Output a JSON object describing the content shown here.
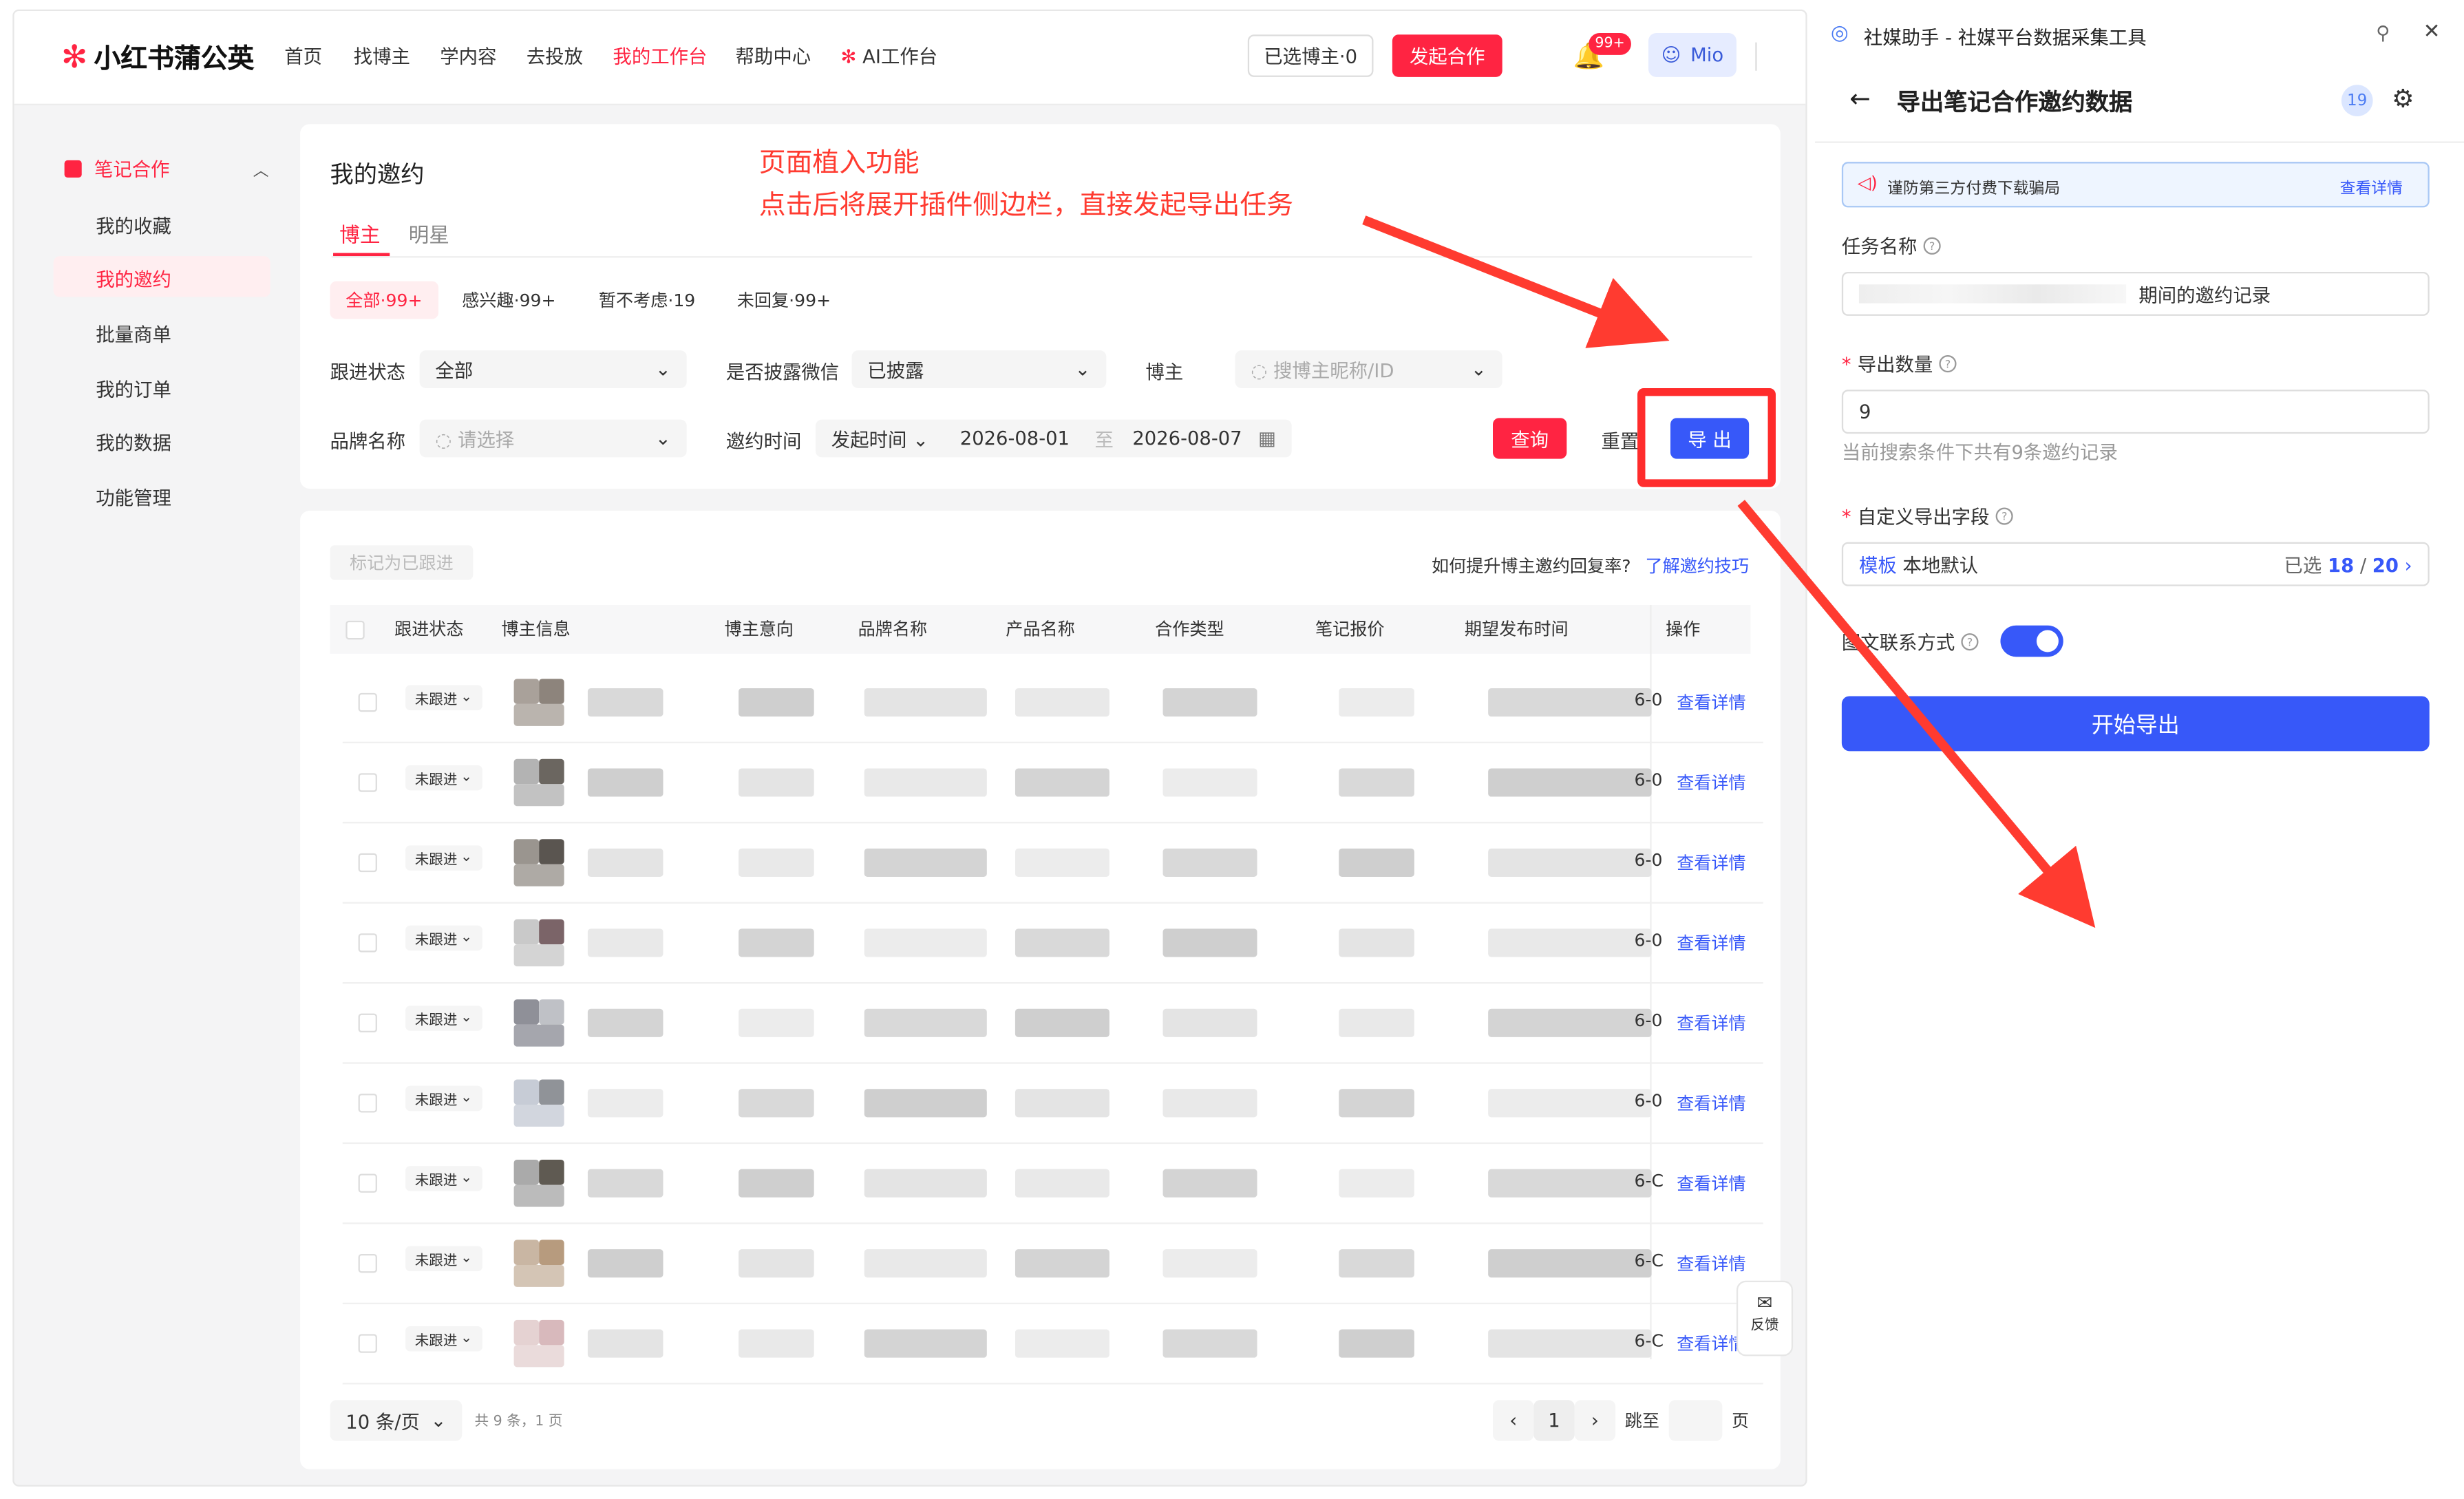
{
  "app": {
    "brand": "小红书蒲公英",
    "nav": [
      "首页",
      "找博主",
      "学内容",
      "去投放",
      "我的工作台",
      "帮助中心",
      "AI工作台"
    ],
    "active_nav": "我的工作台",
    "selected_bloggers": "已选博主·0",
    "start_collab": "发起合作",
    "notif_badge": "99+",
    "user": "Mio"
  },
  "sidebar": {
    "section": "笔记合作",
    "items": [
      "我的收藏",
      "我的邀约",
      "批量商单",
      "我的订单",
      "我的数据",
      "功能管理"
    ],
    "active": "我的邀约"
  },
  "main": {
    "title": "我的邀约",
    "tabs": [
      "博主",
      "明星"
    ],
    "chips": [
      "全部·99+",
      "感兴趣·99+",
      "暂不考虑·19",
      "未回复·99+"
    ],
    "filters": {
      "follow_label": "跟进状态",
      "follow_value": "全部",
      "wechat_label": "是否披露微信",
      "wechat_value": "已披露",
      "blogger_label": "博主",
      "blogger_placeholder": "搜博主昵称/ID",
      "brand_label": "品牌名称",
      "brand_placeholder": "请选择",
      "invite_label": "邀约时间",
      "time_type": "发起时间",
      "date_start": "2026-08-01",
      "date_sep": "至",
      "date_end": "2026-08-07"
    },
    "btn_query": "查询",
    "btn_reset": "重置",
    "btn_export": "导 出",
    "annotation_line1": "页面植入功能",
    "annotation_line2": "点击后将展开插件侧边栏，直接发起导出任务"
  },
  "table": {
    "mark_followed": "标记为已跟进",
    "tip": "如何提升博主邀约回复率?",
    "tip_link": "了解邀约技巧",
    "headers": [
      "跟进状态",
      "博主信息",
      "博主意向",
      "品牌名称",
      "产品名称",
      "合作类型",
      "笔记报价",
      "期望发布时间",
      "操作"
    ],
    "rows": [
      {
        "status": "未跟进",
        "date": "6-0",
        "action": "查看详情"
      },
      {
        "status": "未跟进",
        "date": "6-0",
        "action": "查看详情"
      },
      {
        "status": "未跟进",
        "date": "6-0",
        "action": "查看详情"
      },
      {
        "status": "未跟进",
        "date": "6-0",
        "action": "查看详情"
      },
      {
        "status": "未跟进",
        "date": "6-0",
        "action": "查看详情"
      },
      {
        "status": "未跟进",
        "date": "6-0",
        "action": "查看详情"
      },
      {
        "status": "未跟进",
        "date": "6-C",
        "action": "查看详情"
      },
      {
        "status": "未跟进",
        "date": "6-C",
        "action": "查看详情"
      },
      {
        "status": "未跟进",
        "date": "6-C",
        "action": "查看详情"
      }
    ],
    "page_size": "10 条/页",
    "total": "共 9 条，1 页",
    "page": "1",
    "jump_label": "跳至",
    "page_unit": "页",
    "feedback": "反馈"
  },
  "panel": {
    "window_title": "社媒助手 - 社媒平台数据采集工具",
    "header": "导出笔记合作邀约数据",
    "header_badge": "19",
    "notice": "谨防第三方付费下载骗局",
    "notice_link": "查看详情",
    "task_name_label": "任务名称",
    "task_name_value": "期间的邀约记录",
    "export_count_label": "导出数量",
    "export_count_value": "9",
    "export_count_hint": "当前搜索条件下共有9条邀约记录",
    "fields_label": "自定义导出字段",
    "fields_template_tag": "模板",
    "fields_template": "本地默认",
    "fields_selected_prefix": "已选",
    "fields_selected": "18",
    "fields_total": "20",
    "contact_label": "图文联系方式",
    "start_button": "开始导出"
  }
}
